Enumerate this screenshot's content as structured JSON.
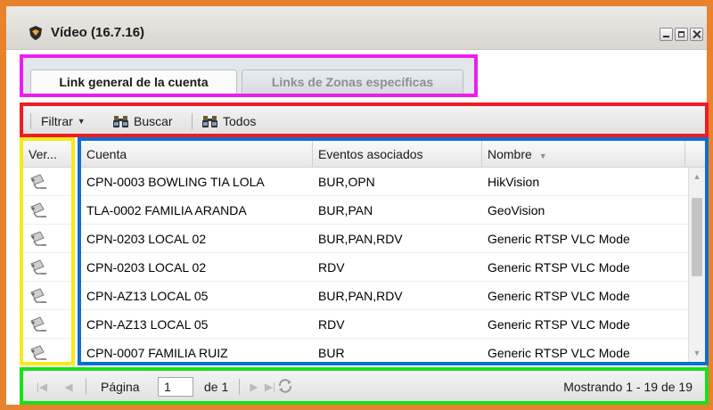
{
  "window": {
    "title": "Vídeo (16.7.16)",
    "icon": "app-shield-icon"
  },
  "tabs": [
    {
      "label": "Link general de la cuenta",
      "active": true
    },
    {
      "label": "Links de Zonas específicas",
      "active": false
    }
  ],
  "toolbar": {
    "filter_label": "Filtrar",
    "search_label": "Buscar",
    "all_label": "Todos"
  },
  "grid": {
    "columns": [
      "Ver...",
      "Cuenta",
      "Eventos asociados",
      "Nombre"
    ],
    "sorted_column": "Nombre",
    "rows": [
      {
        "cuenta": "CPN-0003 BOWLING TIA LOLA",
        "eventos": "BUR,OPN",
        "nombre": "HikVision"
      },
      {
        "cuenta": "TLA-0002 FAMILIA ARANDA",
        "eventos": "BUR,PAN",
        "nombre": "GeoVision"
      },
      {
        "cuenta": "CPN-0203 LOCAL 02",
        "eventos": "BUR,PAN,RDV",
        "nombre": "Generic RTSP VLC Mode"
      },
      {
        "cuenta": "CPN-0203 LOCAL 02",
        "eventos": "RDV",
        "nombre": "Generic RTSP VLC Mode"
      },
      {
        "cuenta": "CPN-AZ13 LOCAL 05",
        "eventos": "BUR,PAN,RDV",
        "nombre": "Generic RTSP VLC Mode"
      },
      {
        "cuenta": "CPN-AZ13 LOCAL 05",
        "eventos": "RDV",
        "nombre": "Generic RTSP VLC Mode"
      },
      {
        "cuenta": "CPN-0007 FAMILIA RUIZ",
        "eventos": "BUR",
        "nombre": "Generic RTSP VLC Mode"
      }
    ]
  },
  "pager": {
    "page_label": "Página",
    "page_value": "1",
    "of_label": "de 1",
    "status": "Mostrando 1 - 19 de 19"
  },
  "colors": {
    "frame": "#e9822d",
    "tabs_outline": "#ee1ded",
    "toolbar_outline": "#ee1c24",
    "view_column_outline": "#f5ea1a",
    "grid_outline": "#0b6fd1",
    "pager_outline": "#1ae01a"
  }
}
